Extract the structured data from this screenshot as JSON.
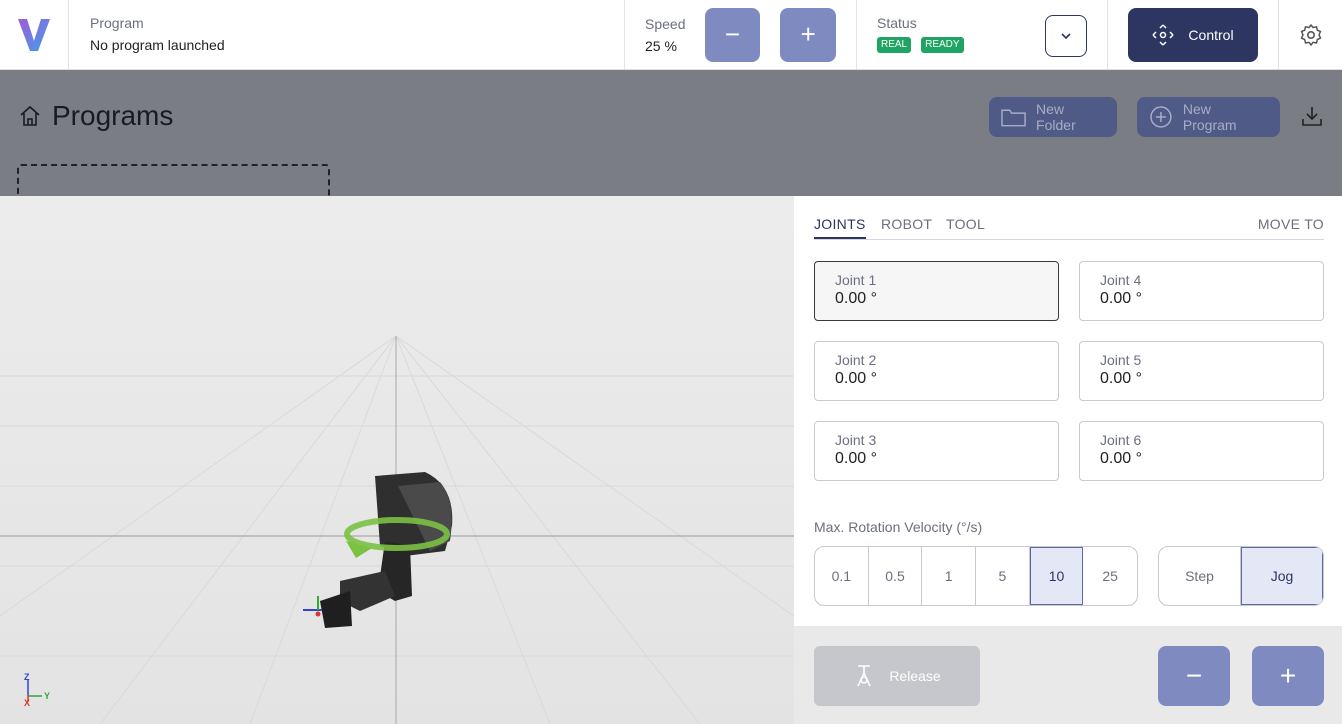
{
  "header": {
    "program_label": "Program",
    "program_value": "No program launched",
    "speed_label": "Speed",
    "speed_value": "25 %",
    "speed_decrease": "−",
    "speed_increase": "+",
    "status_label": "Status",
    "status_badges": [
      "REAL",
      "READY"
    ],
    "control_label": "Control"
  },
  "programs": {
    "title": "Programs",
    "new_folder": "New Folder",
    "new_program": "New Program"
  },
  "axes_gizmo": {
    "z": "Z",
    "y": "Y",
    "x": "X"
  },
  "panel": {
    "tabs": [
      "JOINTS",
      "ROBOT",
      "TOOL"
    ],
    "active_tab": "JOINTS",
    "move_to": "MOVE TO",
    "joints": [
      {
        "label": "Joint 1",
        "value": "0.00 °"
      },
      {
        "label": "Joint 4",
        "value": "0.00 °"
      },
      {
        "label": "Joint 2",
        "value": "0.00 °"
      },
      {
        "label": "Joint 5",
        "value": "0.00 °"
      },
      {
        "label": "Joint 3",
        "value": "0.00 °"
      },
      {
        "label": "Joint 6",
        "value": "0.00 °"
      }
    ],
    "velocity_label": "Max. Rotation Velocity (°/s)",
    "velocity_options": [
      "0.1",
      "0.5",
      "1",
      "5",
      "10",
      "25"
    ],
    "velocity_selected": "10",
    "mode_options": [
      "Step",
      "Jog"
    ],
    "mode_selected": "Jog"
  },
  "bottom": {
    "release_label": "Release",
    "minus": "−",
    "plus": "+"
  },
  "colors": {
    "primary_dark": "#2d3561",
    "primary_light": "#7f8bc0",
    "badge_green": "#1fa463"
  }
}
